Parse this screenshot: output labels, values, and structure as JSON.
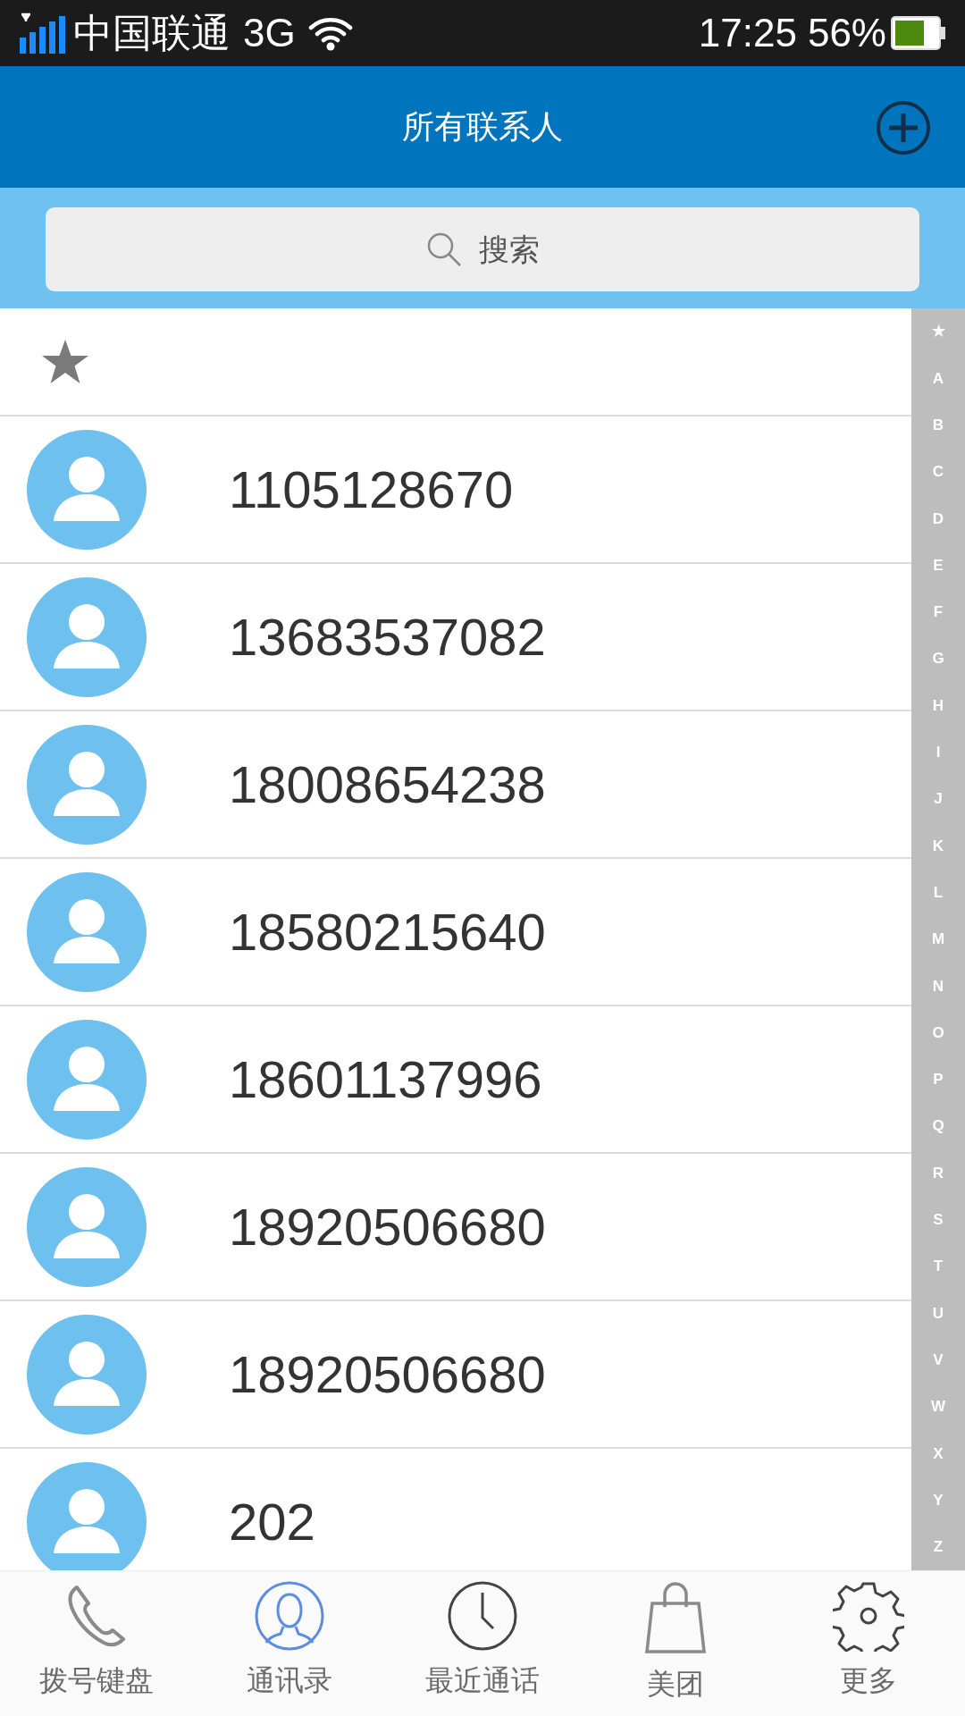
{
  "status_bar": {
    "carrier": "中国联通",
    "network": "3G",
    "time": "17:25",
    "battery_percent": "56%"
  },
  "header": {
    "title": "所有联系人"
  },
  "search": {
    "placeholder": "搜索"
  },
  "favorites_row": {
    "kind": "starred"
  },
  "contacts": [
    {
      "name": "1105128670"
    },
    {
      "name": "13683537082"
    },
    {
      "name": "18008654238"
    },
    {
      "name": "18580215640"
    },
    {
      "name": "18601137996"
    },
    {
      "name": "18920506680"
    },
    {
      "name": "18920506680"
    },
    {
      "name": "202"
    }
  ],
  "index_bar": [
    "★",
    "A",
    "B",
    "C",
    "D",
    "E",
    "F",
    "G",
    "H",
    "I",
    "J",
    "K",
    "L",
    "M",
    "N",
    "O",
    "P",
    "Q",
    "R",
    "S",
    "T",
    "U",
    "V",
    "W",
    "X",
    "Y",
    "Z"
  ],
  "tabs": [
    {
      "label": "拨号键盘",
      "kind": "phone",
      "selected": false
    },
    {
      "label": "通讯录",
      "kind": "contacts",
      "selected": true
    },
    {
      "label": "最近通话",
      "kind": "clock",
      "selected": false
    },
    {
      "label": "美团",
      "kind": "bag",
      "selected": false
    },
    {
      "label": "更多",
      "kind": "gear",
      "selected": false
    }
  ]
}
